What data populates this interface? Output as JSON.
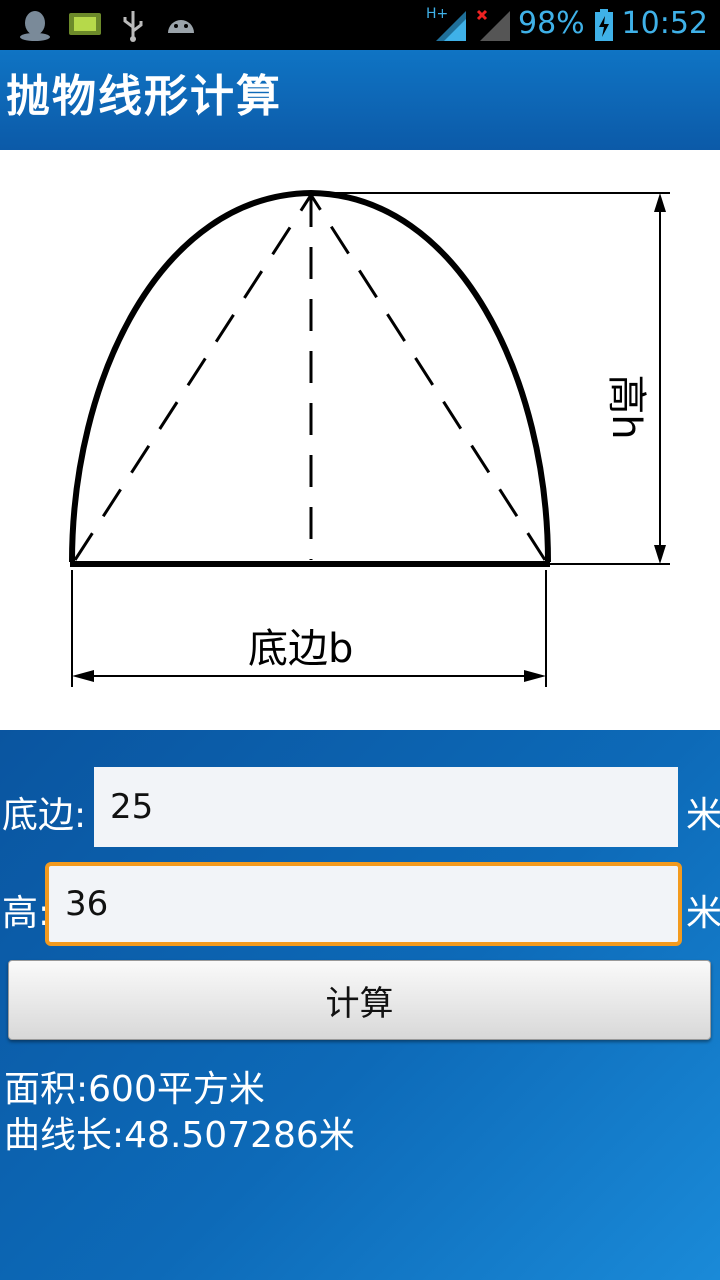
{
  "status_bar": {
    "network_badge": "H+",
    "battery_percent": "98%",
    "time": "10:52",
    "icons": [
      "qq-icon",
      "sd-card-icon",
      "usb-icon",
      "android-icon",
      "signal-icon",
      "signal-no-data-icon",
      "battery-charging-icon"
    ]
  },
  "app": {
    "title": "抛物线形计算"
  },
  "diagram": {
    "height_label": "高h",
    "base_label": "底边b"
  },
  "form": {
    "base_label": "底边:",
    "base_value": "25",
    "base_unit": "米",
    "height_label": "高:",
    "height_value": "36",
    "height_unit": "米",
    "calc_button": "计算"
  },
  "results": {
    "area": "面积:600平方米",
    "curve_length": "曲线长:48.507286米"
  },
  "colors": {
    "accent_focus": "#f39a1e",
    "status_text": "#3fb1e8",
    "title_bar": "#0f74c4"
  }
}
